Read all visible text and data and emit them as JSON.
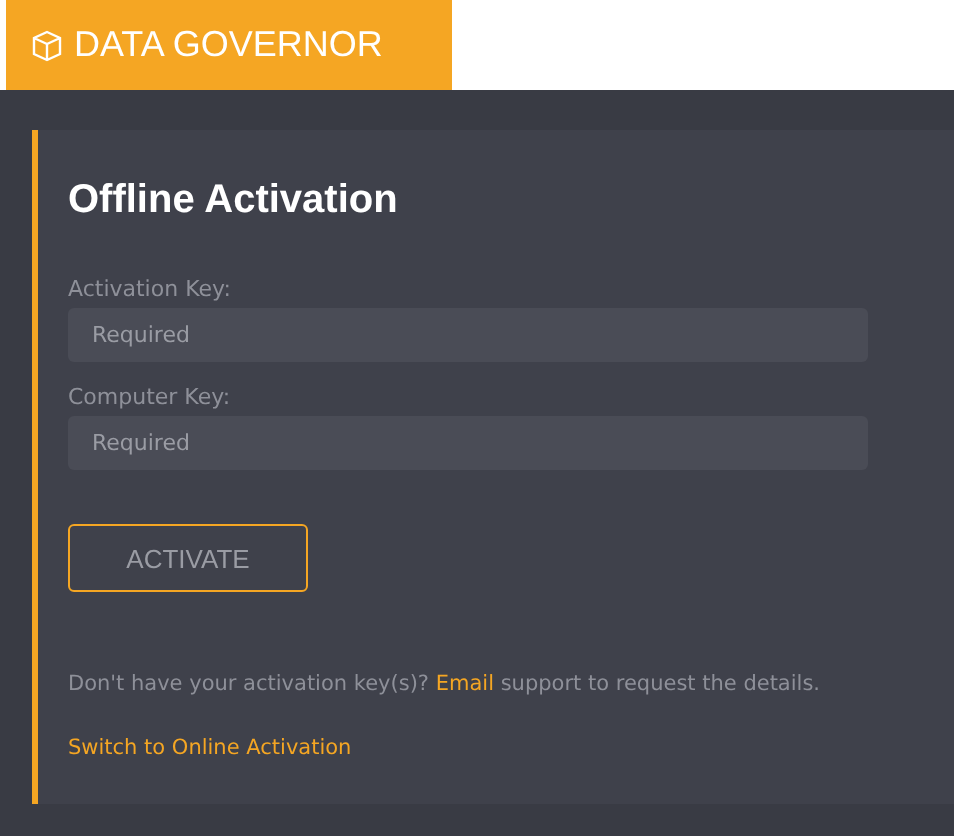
{
  "header": {
    "title": "DATA GOVERNOR"
  },
  "card": {
    "title": "Offline Activation",
    "fields": [
      {
        "label": "Activation Key:",
        "placeholder": "Required"
      },
      {
        "label": "Computer Key:",
        "placeholder": "Required"
      }
    ],
    "button": "ACTIVATE",
    "help": {
      "before": "Don't have your activation key(s)? ",
      "link": "Email",
      "after": " support to request the details."
    },
    "switch_link": "Switch to Online Activation"
  }
}
